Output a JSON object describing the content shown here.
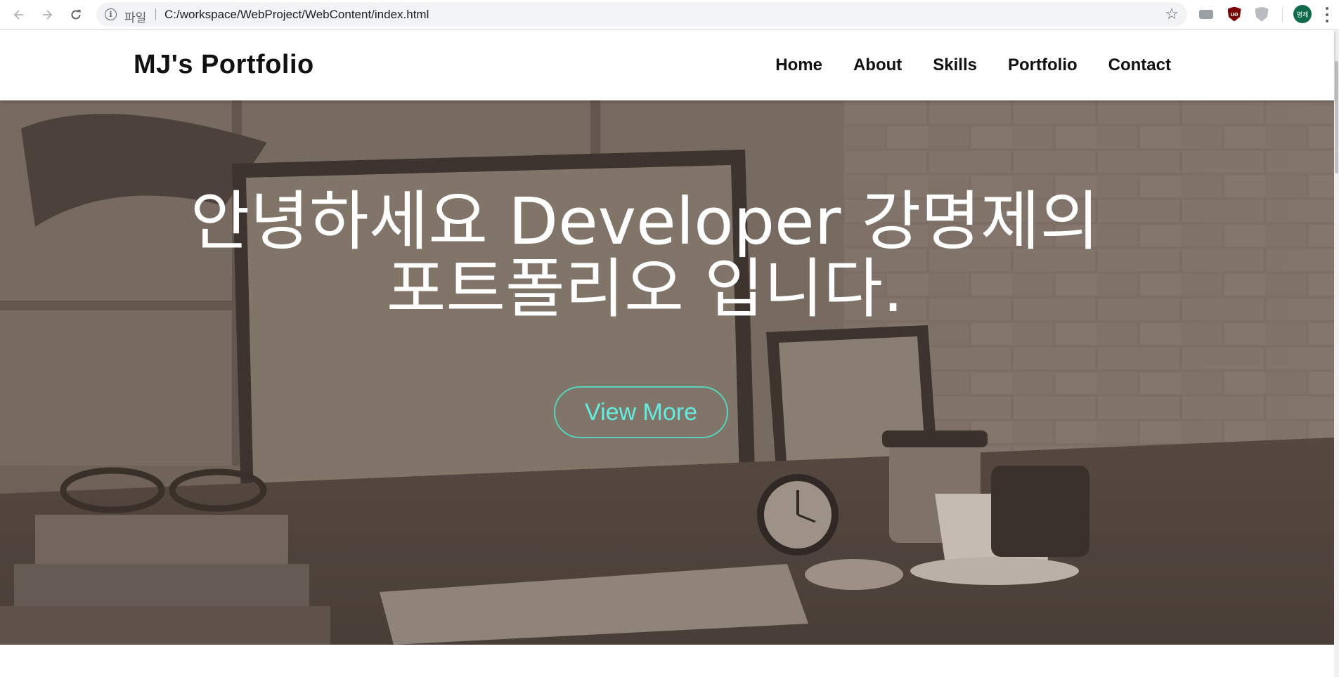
{
  "browser": {
    "scheme_label": "파일",
    "url": "C:/workspace/WebProject/WebContent/index.html",
    "profile_initials": "명제",
    "extension_badge": "uo"
  },
  "site": {
    "logo": "MJ's Portfolio",
    "nav": [
      {
        "label": "Home"
      },
      {
        "label": "About"
      },
      {
        "label": "Skills"
      },
      {
        "label": "Portfolio"
      },
      {
        "label": "Contact"
      }
    ]
  },
  "hero": {
    "title_line1": "안녕하세요 Developer 강명제의",
    "title_line2": "포트폴리오 입니다.",
    "button_label": "View More"
  },
  "colors": {
    "accent_border": "#55d3bd",
    "accent_text": "#63ece0",
    "overlay": "#6f625a"
  }
}
